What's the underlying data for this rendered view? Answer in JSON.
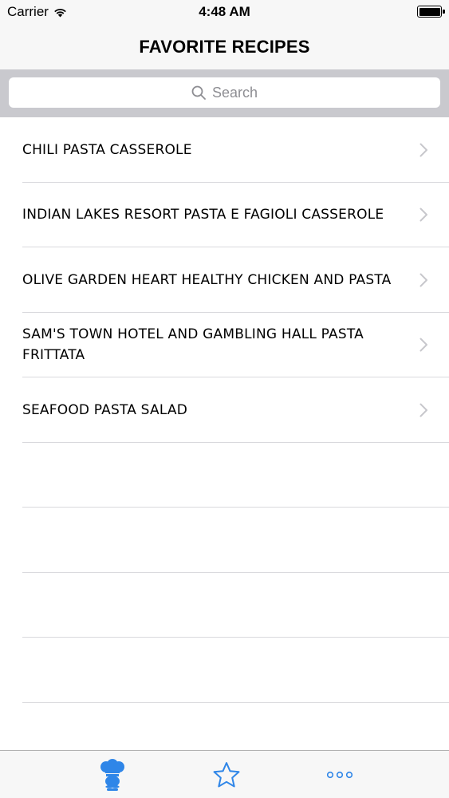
{
  "status_bar": {
    "carrier": "Carrier",
    "time": "4:48 AM",
    "icons": [
      "wifi-icon",
      "battery-icon"
    ]
  },
  "nav": {
    "title": "FAVORITE RECIPES"
  },
  "search": {
    "placeholder": "Search"
  },
  "recipes": [
    {
      "label": "CHILI PASTA CASSEROLE"
    },
    {
      "label": "INDIAN LAKES RESORT PASTA E FAGIOLI CASSEROLE"
    },
    {
      "label": "OLIVE GARDEN HEART HEALTHY CHICKEN AND PASTA"
    },
    {
      "label": "SAM'S TOWN HOTEL AND GAMBLING HALL PASTA FRITTATA"
    },
    {
      "label": "SEAFOOD PASTA SALAD"
    }
  ],
  "tab_bar": {
    "tabs": [
      {
        "icon": "chef-icon",
        "selected": true
      },
      {
        "icon": "star-icon",
        "selected": false
      },
      {
        "icon": "more-icon",
        "selected": false
      }
    ],
    "accent_color": "#2f86e8"
  },
  "colors": {
    "bar_background": "#f7f7f7",
    "search_background": "#c9c9ce",
    "separator": "#d9d9dd",
    "chevron": "#c7c7cc"
  }
}
